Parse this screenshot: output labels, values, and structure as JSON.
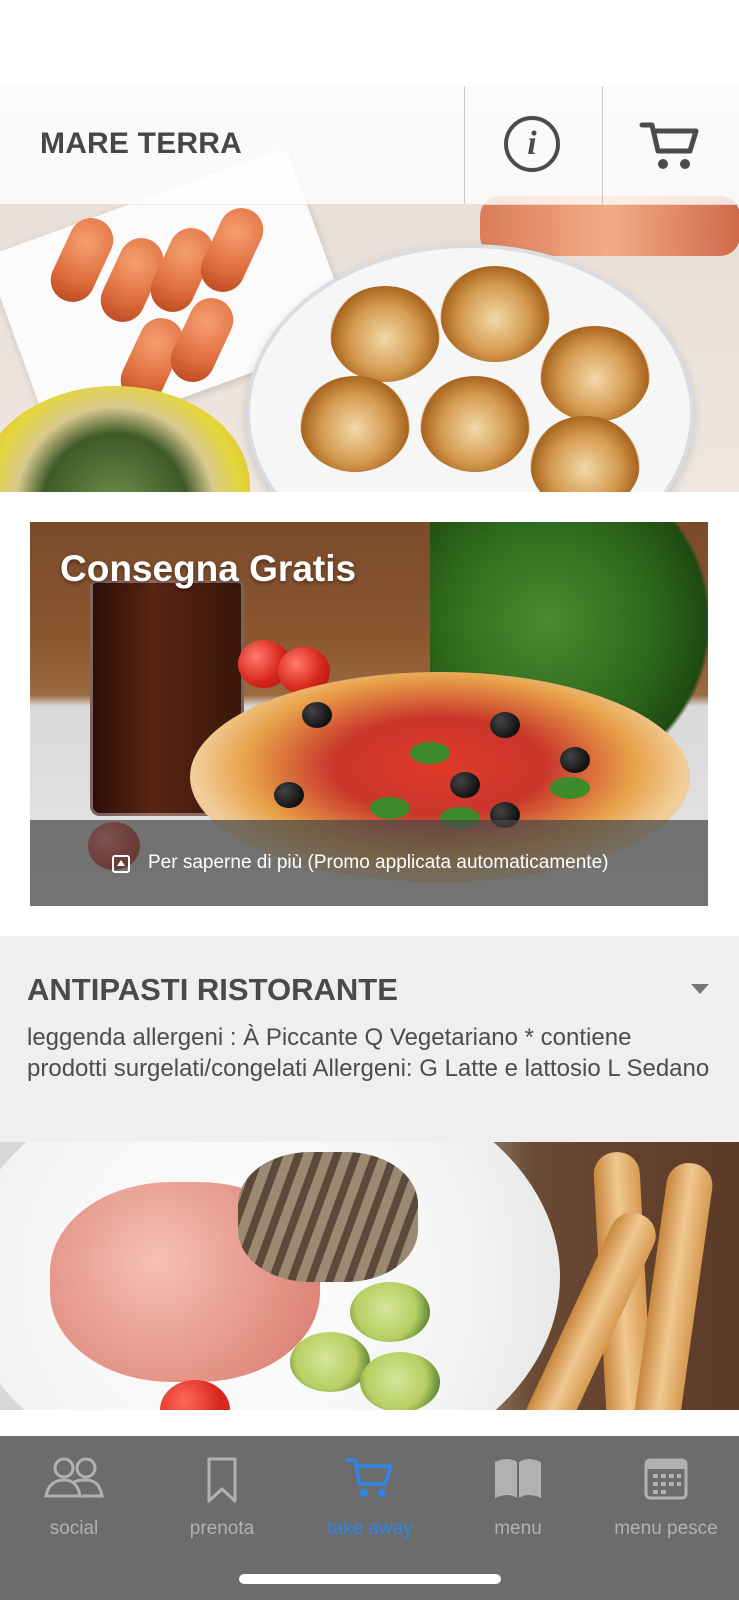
{
  "header": {
    "brand": "MARE TERRA",
    "info_icon": "info-icon",
    "cart_icon": "cart-icon"
  },
  "promo": {
    "title": "Consegna Gratis",
    "caption": "Per saperne di più (Promo applicata automaticamente)",
    "caption_icon": "expand-icon"
  },
  "category": {
    "title": "ANTIPASTI RISTORANTE",
    "description": "leggenda allergeni : À Piccante Q Vegetariano * contiene prodotti surgelati/congelati Allergeni: G Latte e lattosio L Sedano",
    "caret_icon": "chevron-down-icon"
  },
  "tabbar": {
    "tabs": [
      {
        "label": "social",
        "icon": "people-icon",
        "active": false
      },
      {
        "label": "prenota",
        "icon": "bookmark-icon",
        "active": false
      },
      {
        "label": "take away",
        "icon": "cart-icon",
        "active": true
      },
      {
        "label": "menu",
        "icon": "book-icon",
        "active": false
      },
      {
        "label": "menu pesce",
        "icon": "calendar-icon",
        "active": false
      }
    ]
  },
  "colors": {
    "accent": "#2f86ea",
    "tabbar_bg": "#6c6c6c",
    "tab_inactive": "#b1b1b1",
    "category_bg": "#efefef",
    "text_dark": "#474747"
  }
}
